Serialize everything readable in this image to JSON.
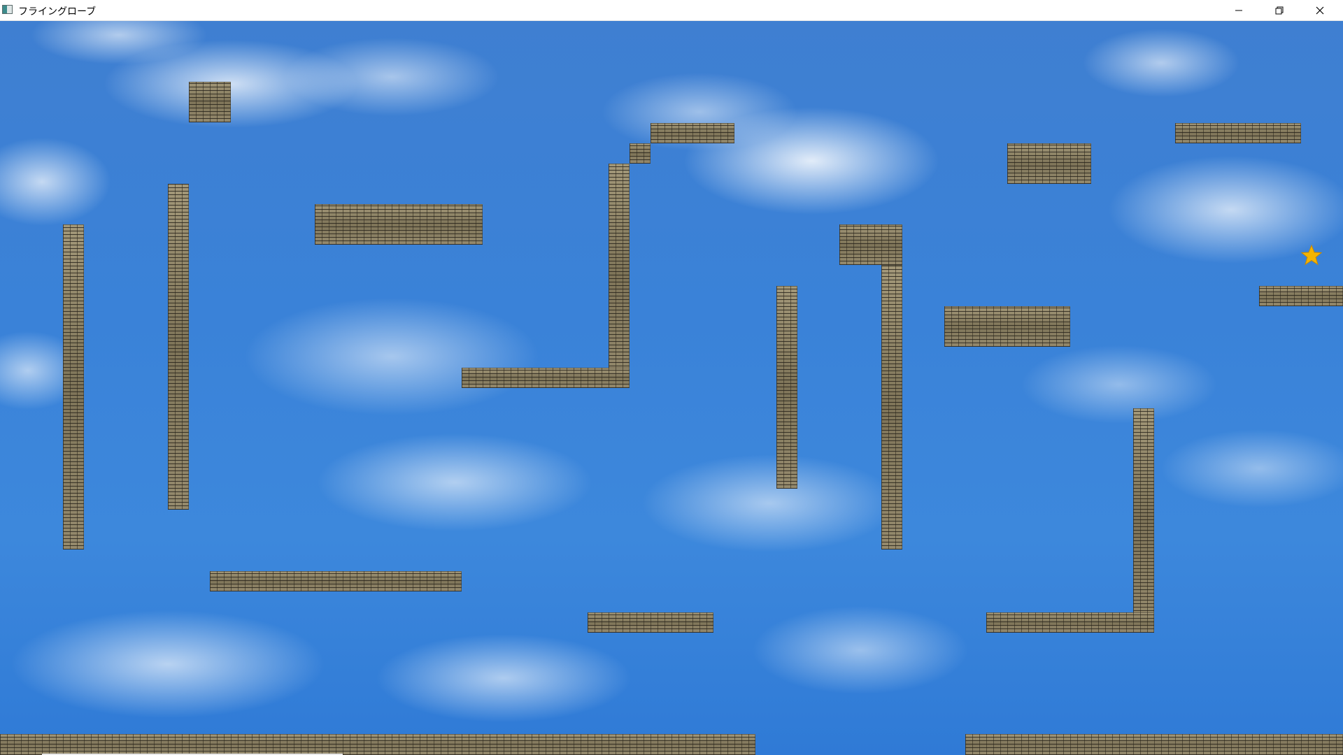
{
  "window": {
    "title": "フライングローブ",
    "app_icon": "app-window-icon",
    "controls": [
      "minimize-icon",
      "restore-icon",
      "close-icon"
    ]
  },
  "game": {
    "background": "sky-with-clouds",
    "colors": {
      "sky": "#3a82d8",
      "brick": "#8a7f62",
      "star": "#f4b400"
    },
    "goal_icon": "star-icon"
  }
}
